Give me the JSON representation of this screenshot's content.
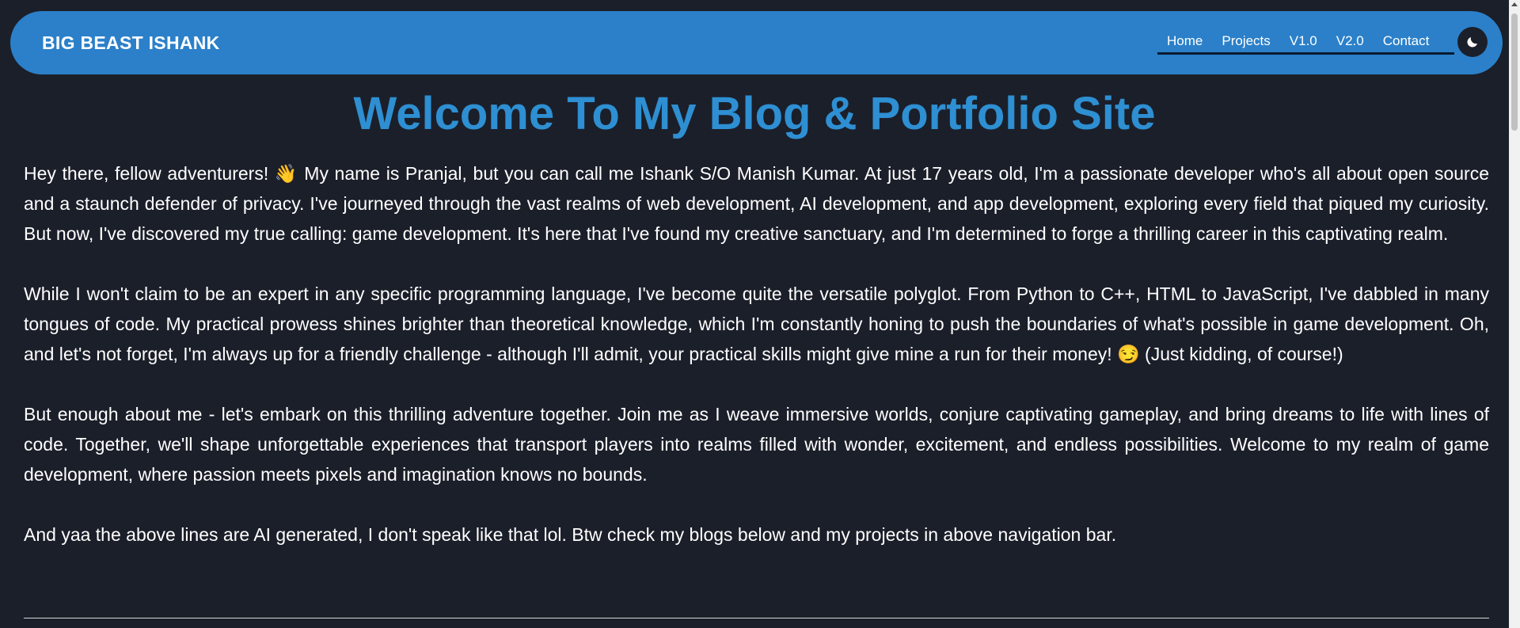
{
  "navbar": {
    "brand": "BIG BEAST ISHANK",
    "links": [
      "Home",
      "Projects",
      "V1.0",
      "V2.0",
      "Contact"
    ],
    "theme_toggle_icon": "moon-icon",
    "background_color": "#2b80c9"
  },
  "main": {
    "headline": "Welcome To My Blog & Portfolio Site",
    "paragraphs": [
      "Hey there, fellow adventurers! 👋 My name is Pranjal, but you can call me Ishank S/O Manish Kumar. At just 17 years old, I'm a passionate developer who's all about open source and a staunch defender of privacy. I've journeyed through the vast realms of web development, AI development, and app development, exploring every field that piqued my curiosity. But now, I've discovered my true calling: game development. It's here that I've found my creative sanctuary, and I'm determined to forge a thrilling career in this captivating realm.",
      "While I won't claim to be an expert in any specific programming language, I've become quite the versatile polyglot. From Python to C++, HTML to JavaScript, I've dabbled in many tongues of code. My practical prowess shines brighter than theoretical knowledge, which I'm constantly honing to push the boundaries of what's possible in game development. Oh, and let's not forget, I'm always up for a friendly challenge - although I'll admit, your practical skills might give mine a run for their money! 😏 (Just kidding, of course!)",
      "But enough about me - let's embark on this thrilling adventure together. Join me as I weave immersive worlds, conjure captivating gameplay, and bring dreams to life with lines of code. Together, we'll shape unforgettable experiences that transport players into realms filled with wonder, excitement, and endless possibilities. Welcome to my realm of game development, where passion meets pixels and imagination knows no bounds.",
      "And yaa the above lines are AI generated, I don't speak like that lol. Btw check my blogs below and my projects in above navigation bar."
    ],
    "headline_color": "#2e8fd2"
  }
}
